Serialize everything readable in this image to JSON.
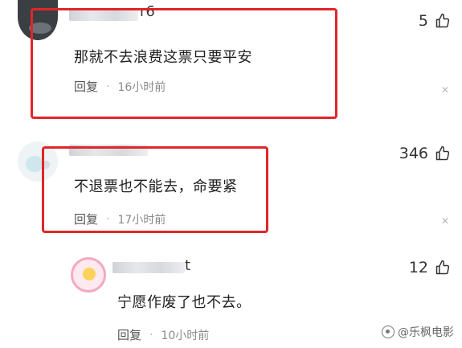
{
  "comments": [
    {
      "username_visible": "r6",
      "text": "那就不去浪费这票只要平安",
      "reply_label": "回复",
      "separator": "·",
      "time": "16小时前",
      "likes": "5"
    },
    {
      "username_visible": "",
      "text": "不退票也不能去，命要紧",
      "reply_label": "回复",
      "separator": "·",
      "time": "17小时前",
      "likes": "346"
    },
    {
      "username_visible": "t",
      "text": "宁愿作废了也不去。",
      "reply_label": "回复",
      "separator": "·",
      "time": "10小时前",
      "likes": "12"
    }
  ],
  "icons": {
    "like": "thumbs-up-icon",
    "close": "close-icon"
  },
  "watermark": {
    "text": "@乐枫电影"
  },
  "colors": {
    "highlight_box": "#e0262a",
    "meta_text": "#8a8a8a"
  }
}
